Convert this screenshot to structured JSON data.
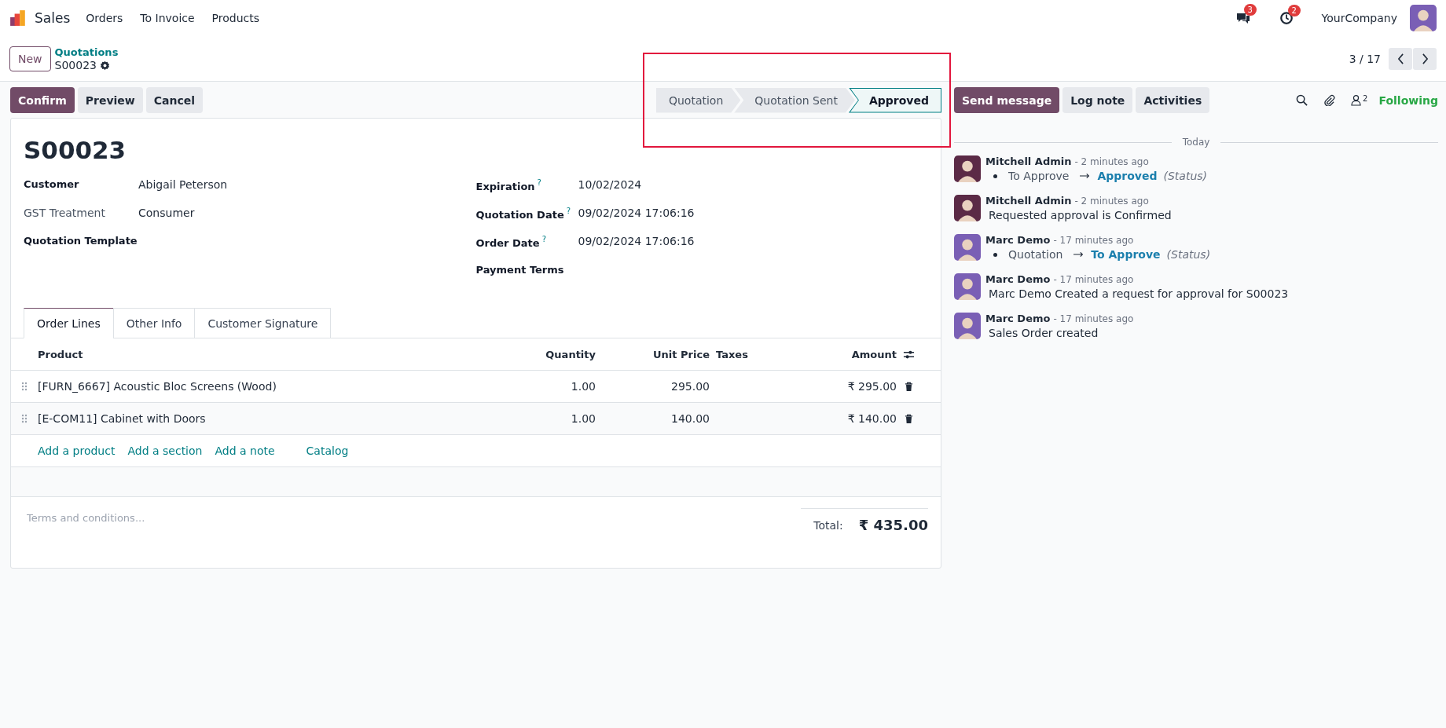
{
  "navbar": {
    "app_name": "Sales",
    "menu": [
      "Orders",
      "To Invoice",
      "Products"
    ],
    "messages_count": "3",
    "activities_count": "2",
    "company": "YourCompany"
  },
  "breadcrumb": {
    "new_button": "New",
    "parent": "Quotations",
    "record": "S00023"
  },
  "pager": {
    "text": "3 / 17"
  },
  "actions": [
    {
      "label": "Confirm",
      "kind": "primary"
    },
    {
      "label": "Preview",
      "kind": "secondary"
    },
    {
      "label": "Cancel",
      "kind": "secondary"
    }
  ],
  "statusbar": [
    {
      "label": "Quotation",
      "selected": false
    },
    {
      "label": "Quotation Sent",
      "selected": false
    },
    {
      "label": "Approved",
      "selected": true
    }
  ],
  "chatter_buttons": [
    {
      "label": "Send message",
      "kind": "primary"
    },
    {
      "label": "Log note",
      "kind": "secondary"
    },
    {
      "label": "Activities",
      "kind": "secondary"
    }
  ],
  "followers_count": "2",
  "following": "Following",
  "form": {
    "title": "S00023",
    "left_fields": [
      {
        "label": "Customer",
        "value": "Abigail Peterson",
        "bold": true
      },
      {
        "label": "GST Treatment",
        "value": "Consumer",
        "bold": false
      },
      {
        "label": "Quotation Template",
        "bold": true
      }
    ],
    "right_fields": [
      {
        "label": "Expiration",
        "help": "?",
        "value": "10/02/2024"
      },
      {
        "label": "Quotation Date",
        "help": "?",
        "value": "09/02/2024 17:06:16"
      },
      {
        "label": "Order Date",
        "help": "?",
        "value": "09/02/2024 17:06:16"
      },
      {
        "label": "Payment Terms"
      }
    ]
  },
  "tabs": [
    {
      "label": "Order Lines",
      "selected": true
    },
    {
      "label": "Other Info",
      "selected": false
    },
    {
      "label": "Customer Signature",
      "selected": false
    }
  ],
  "table": {
    "columns": [
      {
        "label": "Product",
        "kind": "text"
      },
      {
        "label": "Quantity",
        "kind": "number"
      },
      {
        "label": "Unit Price",
        "kind": "number"
      },
      {
        "label": "Taxes",
        "kind": "text"
      },
      {
        "label": "Amount",
        "kind": "number"
      }
    ],
    "rows": [
      {
        "product": "[FURN_6667] Acoustic Bloc Screens (Wood)",
        "quantity": "1.00",
        "unit_price": "295.00",
        "amount": "₹ 295.00"
      },
      {
        "product": "[E-COM11] Cabinet with Doors",
        "quantity": "1.00",
        "unit_price": "140.00",
        "amount": "₹ 140.00"
      }
    ],
    "add_links": [
      "Add a product",
      "Add a section",
      "Add a note",
      "Catalog"
    ]
  },
  "terms_placeholder": "Terms and conditions...",
  "total_label": "Total:",
  "total_value": "₹ 435.00",
  "chatter": {
    "date_separator": "Today",
    "messages": [
      {
        "author": "Mitchell Admin",
        "color": "#5b2a46",
        "time": "- 2 minutes ago",
        "kind": "tracking",
        "old": "To Approve",
        "new": "Approved",
        "field": "(Status)"
      },
      {
        "author": "Mitchell Admin",
        "color": "#5b2a46",
        "time": "- 2 minutes ago",
        "kind": "note",
        "body": "Requested approval is Confirmed"
      },
      {
        "author": "Marc Demo",
        "color": "#7a5fb5",
        "time": "- 17 minutes ago",
        "kind": "tracking",
        "old": "Quotation",
        "new": "To Approve",
        "field": "(Status)"
      },
      {
        "author": "Marc Demo",
        "color": "#7a5fb5",
        "time": "- 17 minutes ago",
        "kind": "note",
        "body": "Marc Demo Created a request for approval for S00023"
      },
      {
        "author": "Marc Demo",
        "color": "#7a5fb5",
        "time": "- 17 minutes ago",
        "kind": "note",
        "body": "Sales Order created"
      }
    ]
  }
}
